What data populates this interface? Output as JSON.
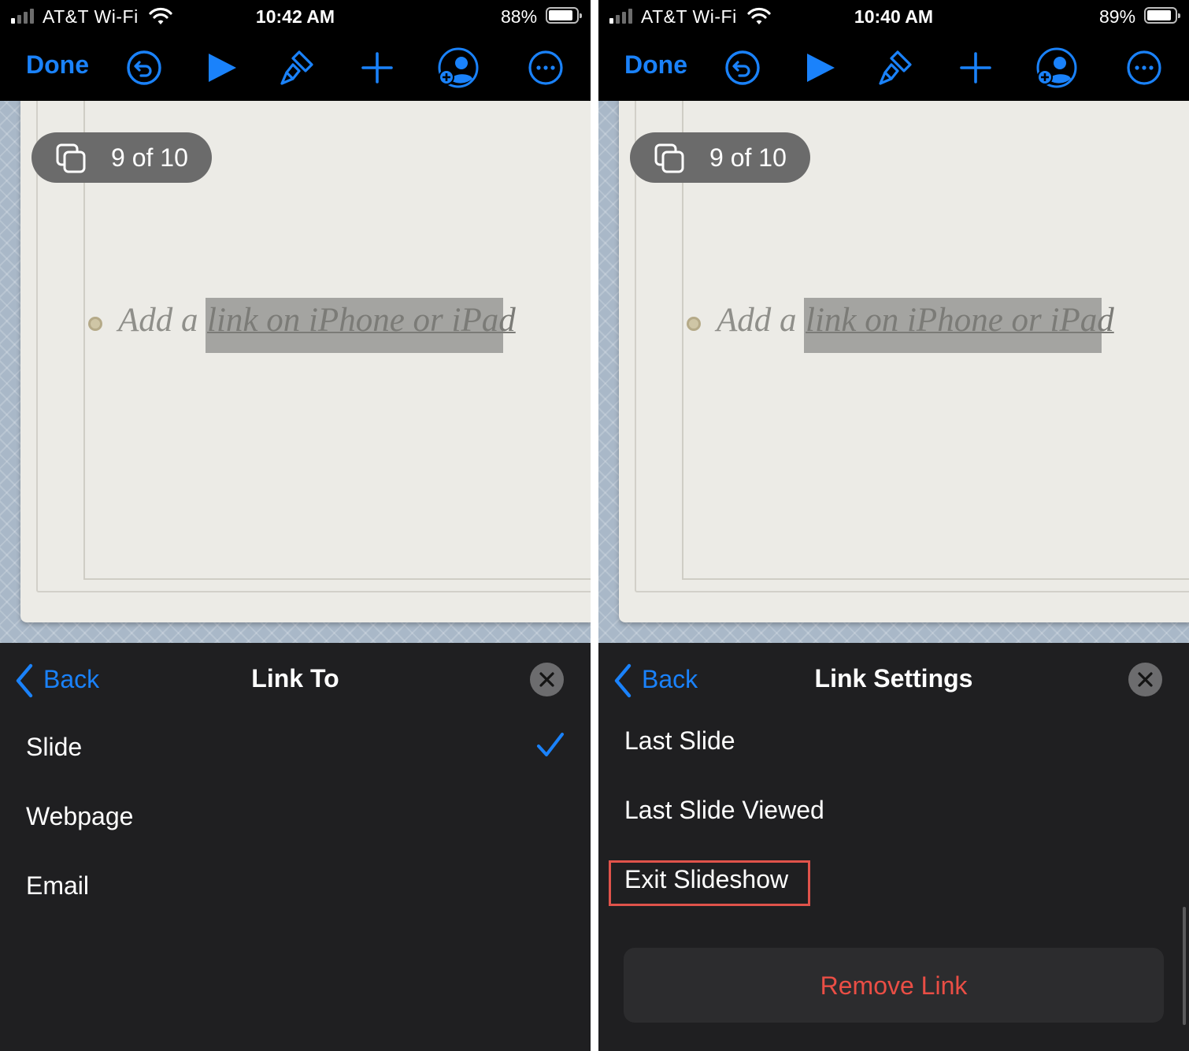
{
  "colors": {
    "accent": "#1a82fb",
    "sheet_background": "#1f1f21",
    "destructive": "#ea4e45",
    "highlight_outline": "#e0534b"
  },
  "screens": {
    "left": {
      "status_bar": {
        "carrier": "AT&T Wi-Fi",
        "time": "10:42 AM",
        "battery_percent": "88%",
        "battery_level": 0.88
      },
      "toolbar": {
        "done_label": "Done",
        "icons": [
          "undo-icon",
          "play-icon",
          "format-brush-icon",
          "add-icon",
          "collaborate-icon",
          "more-icon"
        ]
      },
      "slide": {
        "counter": "9 of 10",
        "text_prefix": "Add a",
        "link_text": "link on iPhone or iPad"
      },
      "sheet": {
        "back_label": "Back",
        "title": "Link To",
        "options": [
          {
            "label": "Slide",
            "checked": true
          },
          {
            "label": "Webpage",
            "checked": false
          },
          {
            "label": "Email",
            "checked": false
          }
        ]
      }
    },
    "right": {
      "status_bar": {
        "carrier": "AT&T Wi-Fi",
        "time": "10:40 AM",
        "battery_percent": "89%",
        "battery_level": 0.89
      },
      "toolbar": {
        "done_label": "Done",
        "icons": [
          "undo-icon",
          "play-icon",
          "format-brush-icon",
          "add-icon",
          "collaborate-icon",
          "more-icon"
        ]
      },
      "slide": {
        "counter": "9 of 10",
        "text_prefix": "Add a",
        "link_text": "link on iPhone or iPad"
      },
      "sheet": {
        "back_label": "Back",
        "title": "Link Settings",
        "options": [
          {
            "label": "Last Slide"
          },
          {
            "label": "Last Slide Viewed"
          },
          {
            "label": "Exit Slideshow",
            "highlighted": true
          }
        ],
        "remove_link_label": "Remove Link"
      }
    }
  }
}
